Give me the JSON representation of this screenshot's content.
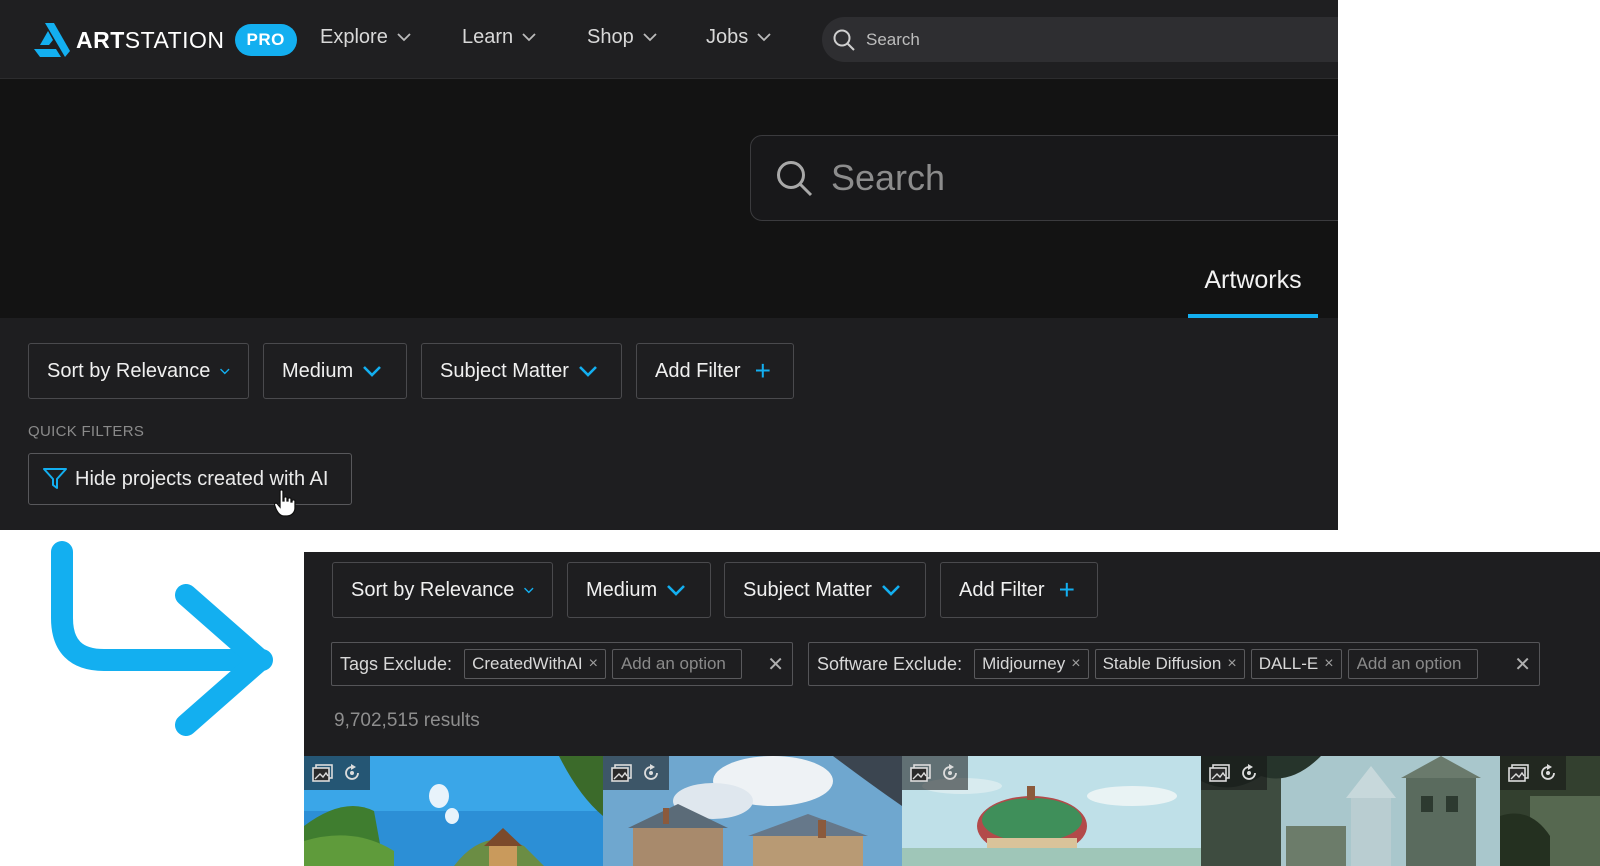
{
  "brand": {
    "name_bold": "ART",
    "name_regular": "STATION",
    "badge": "PRO"
  },
  "nav": {
    "items": [
      {
        "label": "Explore"
      },
      {
        "label": "Learn"
      },
      {
        "label": "Shop"
      },
      {
        "label": "Jobs"
      }
    ],
    "search_placeholder": "Search"
  },
  "main_search": {
    "placeholder": "Search"
  },
  "tabs": {
    "active": "Artworks"
  },
  "filters": {
    "sort": "Sort by Relevance",
    "medium": "Medium",
    "subject": "Subject Matter",
    "add": "Add Filter",
    "add_icon": "+"
  },
  "quick_filters": {
    "label": "QUICK FILTERS",
    "hide_ai": "Hide projects created with AI"
  },
  "applied": {
    "tags_label": "Tags Exclude:",
    "tags": [
      "CreatedWithAI"
    ],
    "software_label": "Software Exclude:",
    "software": [
      "Midjourney",
      "Stable Diffusion",
      "DALL-E"
    ],
    "add_option_placeholder": "Add an option",
    "remove_glyph": "×",
    "clear_glyph": "✕"
  },
  "results_text": "9,702,515 results",
  "colors": {
    "accent": "#13aff0",
    "nav_bg": "#1f1f21",
    "page_bg": "#131313",
    "panel_bg": "#1e1e20"
  },
  "icons": [
    "search-icon",
    "chevron-down-icon",
    "filter-funnel-icon",
    "plus-icon",
    "gallery-icon",
    "rotate-icon",
    "hand-cursor-icon",
    "arrow-icon"
  ]
}
